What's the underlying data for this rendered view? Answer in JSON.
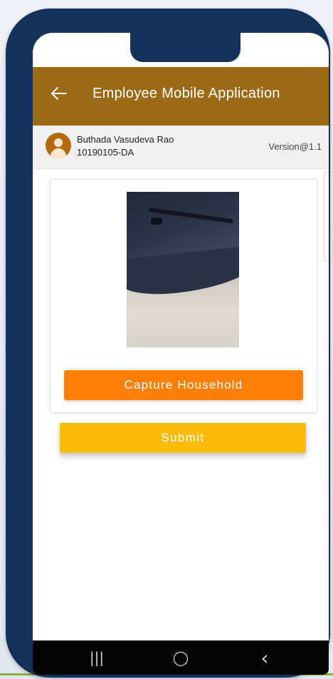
{
  "app_bar": {
    "title": "Employee Mobile Application",
    "back_icon": "arrow-left-icon"
  },
  "user": {
    "name": "Buthada Vasudeva Rao",
    "id": "10190105-DA",
    "version": "Version@1.1",
    "avatar_icon": "user-avatar-icon"
  },
  "capture": {
    "button_label": "Capture Household"
  },
  "submit": {
    "label": "Submit"
  },
  "nav": {
    "recent_glyph": "|||",
    "home_glyph": "◯",
    "back_glyph": "‹"
  },
  "colors": {
    "app_bar": "#9a6a16",
    "capture_button": "#ff8009",
    "submit_button": "#ffbb0a",
    "phone_frame": "#14315a"
  }
}
